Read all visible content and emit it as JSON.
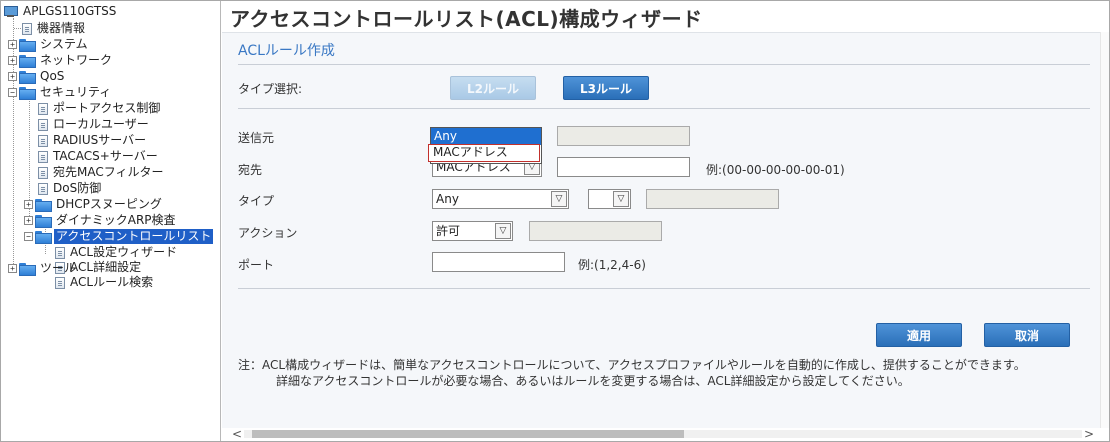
{
  "tree": {
    "root": "APLGS110GTSS",
    "items": [
      {
        "label": "機器情報"
      },
      {
        "label": "システム"
      },
      {
        "label": "ネットワーク"
      },
      {
        "label": "QoS"
      },
      {
        "label": "セキュリティ"
      },
      {
        "label": "ポートアクセス制御"
      },
      {
        "label": "ローカルユーザー"
      },
      {
        "label": "RADIUSサーバー"
      },
      {
        "label": "TACACS+サーバー"
      },
      {
        "label": "宛先MACフィルター"
      },
      {
        "label": "DoS防御"
      },
      {
        "label": "DHCPスヌーピング"
      },
      {
        "label": "ダイナミックARP検査"
      },
      {
        "label": "アクセスコントロールリスト"
      },
      {
        "label": "ACL設定ウィザード"
      },
      {
        "label": "ACL詳細設定"
      },
      {
        "label": "ACLルール検索"
      },
      {
        "label": "ツール"
      }
    ],
    "expand_plus": "+",
    "expand_minus": "−"
  },
  "page": {
    "title": "アクセスコントロールリスト(ACL)構成ウィザード",
    "section_title": "ACLルール作成"
  },
  "form": {
    "type_label": "タイプ選択:",
    "l2_button": "L2ルール",
    "l3_button": "L3ルール",
    "source_label": "送信元",
    "dest_label": "宛先",
    "type2_label": "タイプ",
    "action_label": "アクション",
    "port_label": "ポート",
    "source_dropdown": {
      "options": [
        "Any",
        "MACアドレス"
      ],
      "highlighted": "Any"
    },
    "dest_select": "MACアドレス",
    "dest_hint": "例:(00-00-00-00-00-01)",
    "type_select": "Any",
    "type_sub_select": "",
    "action_select": "許可",
    "port_hint": "例:(1,2,4-6)",
    "arrow_glyph": "▽"
  },
  "buttons": {
    "apply": "適用",
    "cancel": "取消"
  },
  "note": {
    "line1": "注：ACL構成ウィザードは、簡単なアクセスコントロールについて、アクセスプロファイルやルールを自動的に作成し、提供することができます。",
    "line2": "詳細なアクセスコントロールが必要な場合、あるいはルールを変更する場合は、ACL詳細設定から設定してください。"
  },
  "scroll": {
    "left_glyph": "<",
    "right_glyph": ">"
  },
  "colors": {
    "accent": "#3a78c4",
    "selected": "#1f5fc7",
    "highlight_border": "#c2302c"
  }
}
